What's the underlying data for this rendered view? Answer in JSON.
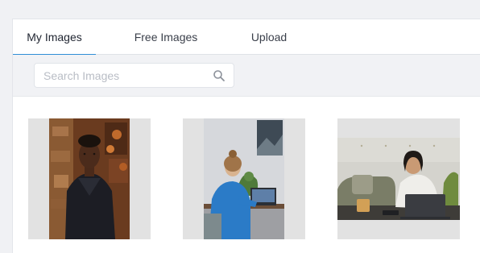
{
  "tabs": [
    {
      "label": "My Images",
      "active": true
    },
    {
      "label": "Free Images",
      "active": false
    },
    {
      "label": "Upload",
      "active": false
    }
  ],
  "search": {
    "placeholder": "Search Images",
    "value": ""
  },
  "colors": {
    "accent": "#2f8fd6",
    "panel_bg": "#ffffff",
    "page_bg": "#f0f1f4"
  },
  "images": [
    {
      "description_icon": "portrait-photo"
    },
    {
      "description_icon": "desk-photo"
    },
    {
      "description_icon": "laptop-photo"
    }
  ]
}
